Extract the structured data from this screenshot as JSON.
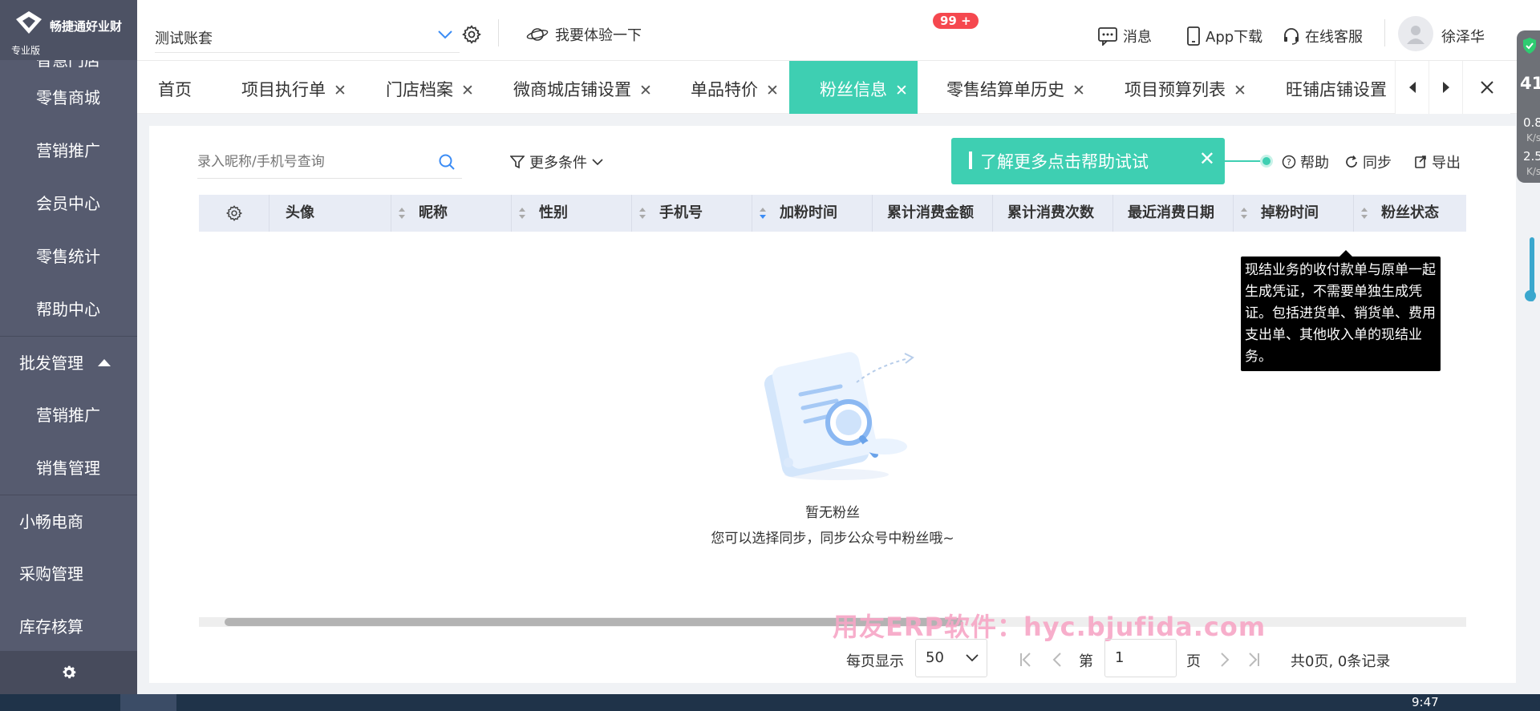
{
  "app": {
    "logo_text": "畅捷通好业财",
    "edition": "专业版"
  },
  "sidebar": {
    "partial_item": "智慧门店",
    "items": [
      {
        "label": "零售商城",
        "level": "sub"
      },
      {
        "label": "营销推广",
        "level": "sub"
      },
      {
        "label": "会员中心",
        "level": "sub"
      },
      {
        "label": "零售统计",
        "level": "sub"
      },
      {
        "label": "帮助中心",
        "level": "sub"
      },
      {
        "label": "批发管理",
        "level": "top",
        "expanded": true
      },
      {
        "label": "营销推广",
        "level": "sub"
      },
      {
        "label": "销售管理",
        "level": "sub"
      },
      {
        "label": "小畅电商",
        "level": "top"
      },
      {
        "label": "采购管理",
        "level": "top"
      },
      {
        "label": "库存核算",
        "level": "top"
      }
    ]
  },
  "header": {
    "account": "测试账套",
    "try_label": "我要体验一下",
    "messages_label": "消息",
    "messages_badge": "99 +",
    "app_download": "App下载",
    "online_service": "在线客服",
    "user_name": "徐泽华"
  },
  "tabs": [
    {
      "label": "首页",
      "closable": false
    },
    {
      "label": "项目执行单",
      "closable": true
    },
    {
      "label": "门店档案",
      "closable": true
    },
    {
      "label": "微商城店铺设置",
      "closable": true
    },
    {
      "label": "单品特价",
      "closable": true
    },
    {
      "label": "粉丝信息",
      "closable": true,
      "active": true
    },
    {
      "label": "零售结算单历史",
      "closable": true
    },
    {
      "label": "项目预算列表",
      "closable": true
    },
    {
      "label": "旺铺店铺设置",
      "closable": true
    }
  ],
  "toolbar": {
    "search_placeholder": "录入昵称/手机号查询",
    "more_filters": "更多条件",
    "help_banner": "了解更多点击帮助试试",
    "help": "帮助",
    "sync": "同步",
    "export": "导出"
  },
  "table": {
    "columns": [
      "头像",
      "昵称",
      "性别",
      "手机号",
      "加粉时间",
      "累计消费金额",
      "累计消费次数",
      "最近消费日期",
      "掉粉时间",
      "粉丝状态"
    ]
  },
  "empty": {
    "title": "暂无粉丝",
    "desc": "您可以选择同步，同步公众号中粉丝哦~"
  },
  "tooltip": {
    "text": "现结业务的收付款单与原单一起生成凭证，不需要单独生成凭证。包括进货单、销货单、费用支出单、其他收入单的现结业务。"
  },
  "watermark": "用友ERP软件：hyc.bjufida.com",
  "pager": {
    "per_page_label": "每页显示",
    "per_page": "50",
    "page_prefix": "第",
    "page_value": "1",
    "page_suffix": "页",
    "summary": "共0页, 0条记录"
  },
  "float_widget": {
    "num": "41",
    "up": "0.8",
    "up_unit": "K/s",
    "down": "2.5",
    "down_unit": "K/s"
  },
  "taskbar": {
    "clock": "9:47"
  },
  "colors": {
    "accent": "#3ecfb2",
    "sidebar": "#565b6f",
    "badge": "#f5484f",
    "tooltip": "#000000"
  }
}
